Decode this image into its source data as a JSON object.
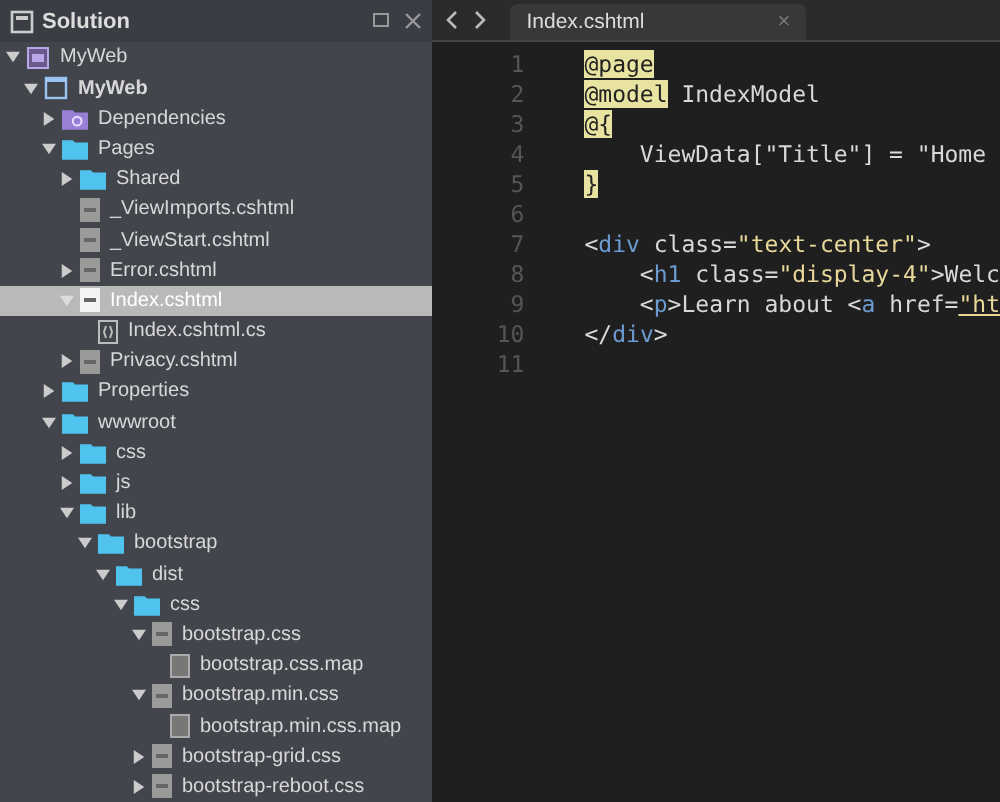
{
  "sidebar": {
    "title": "Solution",
    "tree": [
      {
        "label": "MyWeb",
        "kind": "solution",
        "expanded": true,
        "selected": false,
        "children": [
          {
            "label": "MyWeb",
            "kind": "project",
            "expanded": true,
            "selected": false,
            "children": [
              {
                "label": "Dependencies",
                "kind": "dependencies",
                "expanded": false,
                "selected": false
              },
              {
                "label": "Pages",
                "kind": "folder",
                "expanded": true,
                "selected": false,
                "children": [
                  {
                    "label": "Shared",
                    "kind": "folder",
                    "expanded": false,
                    "selected": false
                  },
                  {
                    "label": "_ViewImports.cshtml",
                    "kind": "file",
                    "selected": false
                  },
                  {
                    "label": "_ViewStart.cshtml",
                    "kind": "file",
                    "selected": false
                  },
                  {
                    "label": "Error.cshtml",
                    "kind": "file",
                    "expanded": false,
                    "selected": false
                  },
                  {
                    "label": "Index.cshtml",
                    "kind": "file",
                    "expanded": true,
                    "selected": true,
                    "children": [
                      {
                        "label": "Index.cshtml.cs",
                        "kind": "code",
                        "selected": false
                      }
                    ]
                  },
                  {
                    "label": "Privacy.cshtml",
                    "kind": "file",
                    "expanded": false,
                    "selected": false
                  }
                ]
              },
              {
                "label": "Properties",
                "kind": "folder",
                "expanded": false,
                "selected": false
              },
              {
                "label": "wwwroot",
                "kind": "folder",
                "expanded": true,
                "selected": false,
                "children": [
                  {
                    "label": "css",
                    "kind": "folder",
                    "expanded": false,
                    "selected": false
                  },
                  {
                    "label": "js",
                    "kind": "folder",
                    "expanded": false,
                    "selected": false
                  },
                  {
                    "label": "lib",
                    "kind": "folder",
                    "expanded": true,
                    "selected": false,
                    "children": [
                      {
                        "label": "bootstrap",
                        "kind": "folder",
                        "expanded": true,
                        "selected": false,
                        "children": [
                          {
                            "label": "dist",
                            "kind": "folder",
                            "expanded": true,
                            "selected": false,
                            "children": [
                              {
                                "label": "css",
                                "kind": "folder",
                                "expanded": true,
                                "selected": false,
                                "children": [
                                  {
                                    "label": "bootstrap.css",
                                    "kind": "file",
                                    "expanded": true,
                                    "selected": false,
                                    "children": [
                                      {
                                        "label": "bootstrap.css.map",
                                        "kind": "doc",
                                        "selected": false
                                      }
                                    ]
                                  },
                                  {
                                    "label": "bootstrap.min.css",
                                    "kind": "file",
                                    "expanded": true,
                                    "selected": false,
                                    "children": [
                                      {
                                        "label": "bootstrap.min.css.map",
                                        "kind": "doc",
                                        "selected": false
                                      }
                                    ]
                                  },
                                  {
                                    "label": "bootstrap-grid.css",
                                    "kind": "file",
                                    "expanded": false,
                                    "selected": false
                                  },
                                  {
                                    "label": "bootstrap-reboot.css",
                                    "kind": "file",
                                    "expanded": false,
                                    "selected": false
                                  }
                                ]
                              }
                            ]
                          }
                        ]
                      }
                    ]
                  }
                ]
              }
            ]
          }
        ]
      }
    ]
  },
  "editor": {
    "tabs": [
      {
        "label": "Index.cshtml",
        "close": "×",
        "selected": true
      }
    ],
    "lines": [
      {
        "number": "1",
        "tokens": [
          {
            "kind": "razor",
            "text": "@page"
          }
        ]
      },
      {
        "number": "2",
        "tokens": [
          {
            "kind": "razor",
            "text": "@model"
          },
          {
            "kind": "plain",
            "text": " IndexModel"
          }
        ]
      },
      {
        "number": "3",
        "tokens": [
          {
            "kind": "razor",
            "text": "@{"
          }
        ]
      },
      {
        "number": "4",
        "tokens": [
          {
            "kind": "plain",
            "text": "    ViewData[\"Title\"] = \"Home"
          }
        ]
      },
      {
        "number": "5",
        "tokens": [
          {
            "kind": "razor",
            "text": "}"
          }
        ]
      },
      {
        "number": "6"
      },
      {
        "number": "7",
        "tokens": [
          {
            "kind": "plain",
            "text": "<"
          },
          {
            "kind": "tag",
            "text": "div"
          },
          {
            "kind": "plain",
            "text": " class="
          },
          {
            "kind": "string",
            "text": "\"text-center\""
          },
          {
            "kind": "plain",
            "text": ">"
          }
        ]
      },
      {
        "number": "8",
        "tokens": [
          {
            "kind": "plain",
            "text": "    <"
          },
          {
            "kind": "tag",
            "text": "h1"
          },
          {
            "kind": "plain",
            "text": " class="
          },
          {
            "kind": "string",
            "text": "\"display-4\""
          },
          {
            "kind": "plain",
            "text": ">Welc"
          }
        ]
      },
      {
        "number": "9",
        "tokens": [
          {
            "kind": "plain",
            "text": "    <"
          },
          {
            "kind": "tag",
            "text": "p"
          },
          {
            "kind": "plain",
            "text": ">Learn about <"
          },
          {
            "kind": "tag",
            "text": "a"
          },
          {
            "kind": "plain",
            "text": " href="
          },
          {
            "kind": "link",
            "text": "\"ht"
          }
        ]
      },
      {
        "number": "10",
        "tokens": [
          {
            "kind": "plain",
            "text": "</"
          },
          {
            "kind": "tag",
            "text": "div"
          },
          {
            "kind": "plain",
            "text": ">"
          }
        ]
      },
      {
        "number": "11"
      }
    ]
  }
}
